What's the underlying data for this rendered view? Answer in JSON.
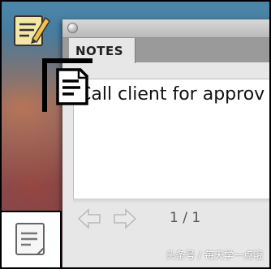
{
  "notes_window": {
    "tab_label": "NOTES",
    "note_text": "Call client for approv",
    "page_indicator": "1 / 1"
  },
  "icons": {
    "desktop_icon": "notes-pencil-icon",
    "callout_icon": "note-page-icon",
    "bottom_icon": "note-page-icon",
    "prev_arrow": "left-arrow-icon",
    "next_arrow": "right-arrow-icon",
    "close": "close-icon"
  },
  "watermark": "头条号 / 每天学一点哦",
  "colors": {
    "window_bg": "#e7e7e7",
    "tabbar_bg": "#9a9a9a",
    "callout": "#000000",
    "note_text": "#111111"
  }
}
